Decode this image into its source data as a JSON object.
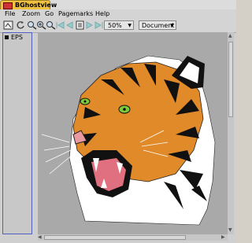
{
  "window": {
    "title": "BGhostview"
  },
  "menu": {
    "items": [
      "File",
      "Zoom",
      "Go",
      "Pagemarks",
      "Help"
    ]
  },
  "toolbar": {
    "zoom_value": "50%",
    "view_value": "Document"
  },
  "sidebar": {
    "pages": [
      {
        "label": "EPS"
      }
    ]
  },
  "colors": {
    "title_tab": "#f0c040",
    "viewer_bg": "#a9a9a9",
    "sidebar_border": "#5060c0"
  }
}
